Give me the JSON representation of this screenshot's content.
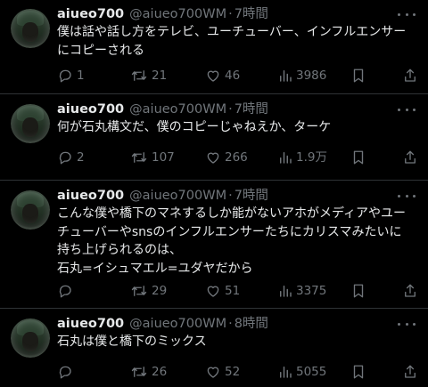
{
  "tweets": [
    {
      "name": "aiueo700",
      "handle": "@aiueo700WM",
      "separator": "·",
      "time": "7時間",
      "lines": [
        "僕は話や話し方をテレビ、ユーチューバー、インフルエンサー",
        "にコピーされる"
      ],
      "replies": "1",
      "retweets": "21",
      "likes": "46",
      "views": "3986"
    },
    {
      "name": "aiueo700",
      "handle": "@aiueo700WM",
      "separator": "·",
      "time": "7時間",
      "lines": [
        "何が石丸構文だ、僕のコピーじゃねえか、ターケ"
      ],
      "replies": "2",
      "retweets": "107",
      "likes": "266",
      "views": "1.9万"
    },
    {
      "name": "aiueo700",
      "handle": "@aiueo700WM",
      "separator": "·",
      "time": "7時間",
      "lines": [
        "こんな僕や橋下のマネするしか能がないアホがメディアやユー",
        "チューバーやsnsのインフルエンサーたちにカリスマみたいに",
        "持ち上げられるのは、",
        "石丸=イシュマエル=ユダヤだから"
      ],
      "replies": "",
      "retweets": "29",
      "likes": "51",
      "views": "3375"
    },
    {
      "name": "aiueo700",
      "handle": "@aiueo700WM",
      "separator": "·",
      "time": "8時間",
      "lines": [
        "石丸は僕と橋下のミックス"
      ],
      "replies": "",
      "retweets": "26",
      "likes": "52",
      "views": "5055"
    }
  ],
  "colors": {
    "background": "#000000",
    "text": "#e7e9ea",
    "muted": "#71767b",
    "divider": "#2f3336"
  },
  "icons": [
    "reply-icon",
    "retweet-icon",
    "like-icon",
    "views-icon",
    "bookmark-icon",
    "share-icon",
    "more-icon"
  ]
}
